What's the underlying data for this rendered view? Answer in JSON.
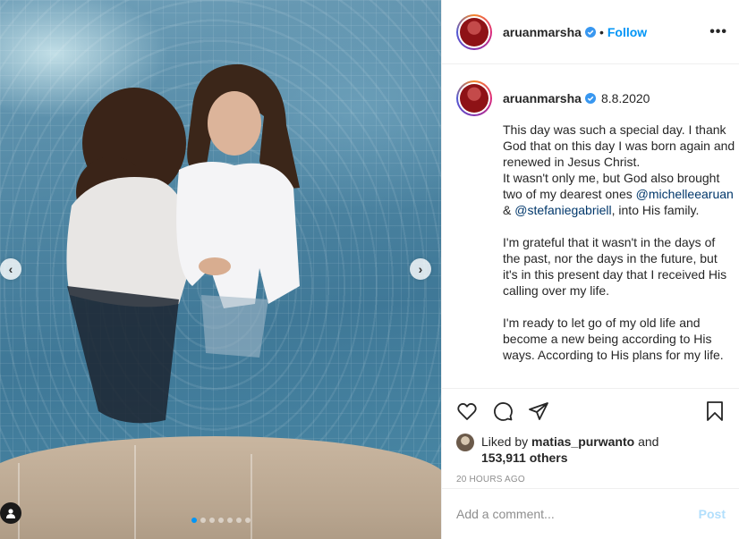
{
  "post": {
    "username": "aruanmarsha",
    "verified": true,
    "follow_label": "Follow",
    "separator": "•",
    "more_label": "•••"
  },
  "caption": {
    "username": "aruanmarsha",
    "date": "8.8.2020",
    "para1_lines": [
      "This day was such a special day. I thank God that on this day I was born again and renewed in Jesus Christ.",
      "It wasn't only me, but God also brought two of my dearest ones"
    ],
    "mention1": "@michelleearuan",
    "amp": " & ",
    "mention2": "@stefaniegabriell",
    "para1_end": ", into His family.",
    "para2": "I'm grateful that it wasn't in the days of the past, nor the days in the future, but it's in this present day that I received His calling over my life.",
    "para3": "I'm ready to let go of my old life and become a new being according to His ways. According to His plans for my life."
  },
  "actions": {
    "icons": [
      "heart-icon",
      "comment-icon",
      "share-icon",
      "bookmark-icon"
    ]
  },
  "likes": {
    "prefix": "Liked by ",
    "user": "matias_purwanto",
    "middle": " and ",
    "count": "153,911 others"
  },
  "time_ago": "20 HOURS AGO",
  "comment_box": {
    "placeholder": "Add a comment...",
    "post_label": "Post"
  },
  "carousel": {
    "total": 7,
    "active_index": 0,
    "prev_icon": "‹",
    "next_icon": "›"
  },
  "colors": {
    "accent": "#0095f6",
    "verified": "#3897f0",
    "post_disabled": "#b2dffc",
    "mention": "#00376b",
    "muted": "#8e8e8e"
  }
}
